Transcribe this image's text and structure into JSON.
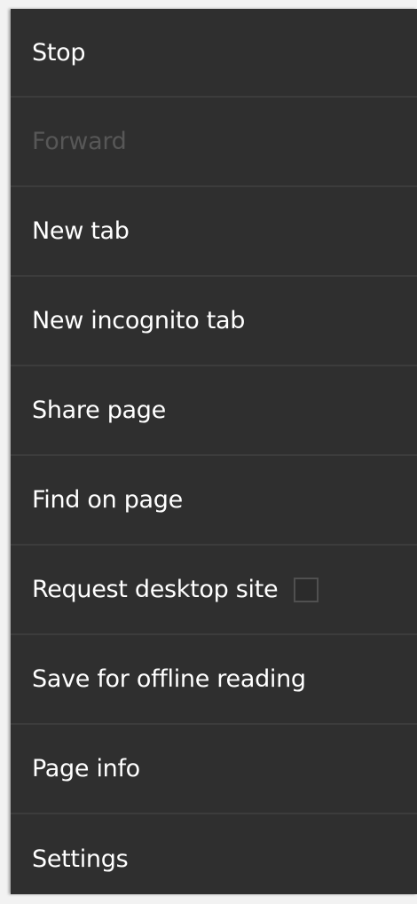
{
  "menu": {
    "items": [
      {
        "label": "Stop",
        "enabled": true
      },
      {
        "label": "Forward",
        "enabled": false
      },
      {
        "label": "New tab",
        "enabled": true
      },
      {
        "label": "New incognito tab",
        "enabled": true
      },
      {
        "label": "Share page",
        "enabled": true
      },
      {
        "label": "Find on page",
        "enabled": true
      },
      {
        "label": "Request desktop site",
        "enabled": true,
        "checkbox": {
          "checked": false
        }
      },
      {
        "label": "Save for offline reading",
        "enabled": true
      },
      {
        "label": "Page info",
        "enabled": true
      },
      {
        "label": "Settings",
        "enabled": true
      }
    ],
    "colors": {
      "background": "#2f2f2f",
      "divider": "#3c3c3c",
      "text": "#ffffff",
      "disabled_text": "#575757"
    }
  }
}
